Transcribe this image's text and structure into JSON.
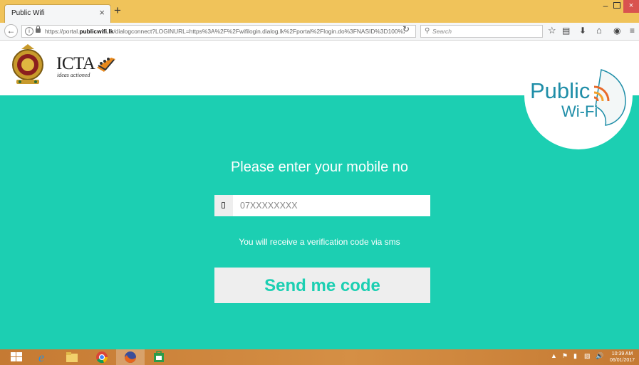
{
  "browser": {
    "tab_title": "Public Wifi",
    "tab_close": "×",
    "new_tab": "+",
    "url_host": "https://portal.",
    "url_domain": "publicwifi.lk",
    "url_path": "/dialogconnect?LOGINURL=https%3A%2F%2Fwifilogin.dialog.lk%2Fportal%2Flogin.do%3FNASID%3D100%26M",
    "search_placeholder": "Search",
    "window_min": "–",
    "window_close": "×"
  },
  "header": {
    "logo_text": "ICTA",
    "logo_tagline": "ideas actioned"
  },
  "badge": {
    "line1": "Public",
    "line2": "Wi-Fi"
  },
  "form": {
    "heading": "Please enter your mobile no",
    "phone_placeholder": "07XXXXXXXX",
    "helper_text": "You will receive a verification code via sms",
    "submit_label": "Send me code"
  },
  "taskbar": {
    "clock_time": "10:39 AM",
    "clock_date": "06/01/2017"
  },
  "colors": {
    "brand_teal": "#1ccfb2",
    "titlebar": "#f0c35a",
    "taskbar": "#c9803a"
  }
}
